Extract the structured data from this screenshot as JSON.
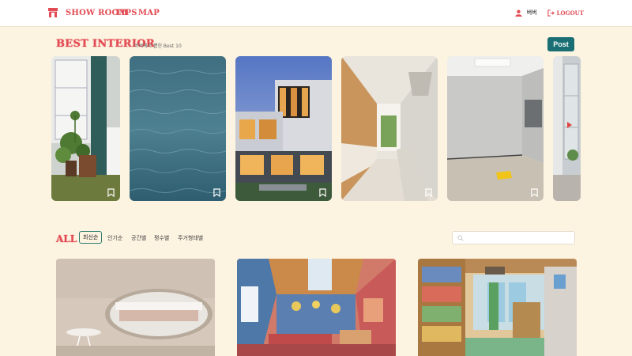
{
  "header": {
    "nav": [
      "SHOW ROOM",
      "TIPS",
      "MAP"
    ],
    "user_name": "버버",
    "logout_label": "LOGOUT"
  },
  "best": {
    "title": "BEST INTERIOR",
    "subtitle": "버버에서 뽑힌 Best 10",
    "post_label": "Post"
  },
  "all": {
    "title": "ALL",
    "tabs": [
      "최신순",
      "인기순",
      "공간별",
      "평수별",
      "주거형태별"
    ],
    "search_value": ""
  },
  "colors": {
    "accent": "#e24b53",
    "teal": "#196f73",
    "background": "#fdf3e1"
  },
  "icons": [
    "home-logo-icon",
    "user-icon",
    "logout-icon",
    "bookmark-icon",
    "search-icon"
  ]
}
